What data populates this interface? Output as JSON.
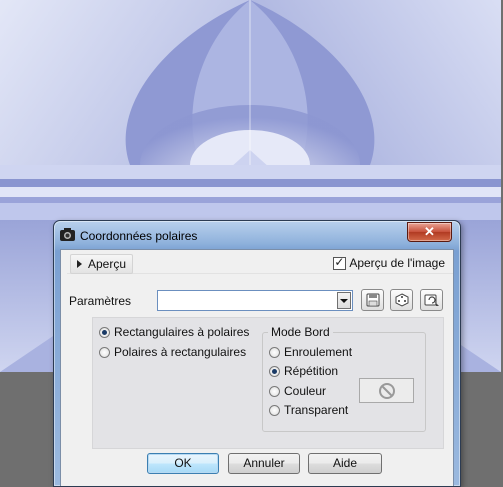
{
  "dialog": {
    "title": "Coordonnées polaires",
    "close_icon": "close-icon",
    "close_glyph": "✕",
    "preview": {
      "toggle_label": "Aperçu",
      "image_preview_label": "Aperçu de l'image",
      "image_preview_checked": true,
      "check_glyph": "✓"
    },
    "params": {
      "label": "Paramètres",
      "preset_value": "",
      "tools": [
        "save-preset-icon",
        "randomize-dice-icon",
        "reset-settings-icon"
      ]
    },
    "conversion": {
      "options": [
        {
          "label": "Rectangulaires à polaires",
          "selected": true
        },
        {
          "label": "Polaires à rectangulaires",
          "selected": false
        }
      ]
    },
    "edge_mode": {
      "title": "Mode Bord",
      "options": [
        {
          "label": "Enroulement",
          "selected": false
        },
        {
          "label": "Répétition",
          "selected": true
        },
        {
          "label": "Couleur",
          "selected": false
        },
        {
          "label": "Transparent",
          "selected": false
        }
      ],
      "color_swatch_icon": "no-color-icon"
    },
    "buttons": {
      "ok": "OK",
      "cancel": "Annuler",
      "help": "Aide"
    }
  },
  "colors": {
    "canvas_light": "#dfe3f5",
    "canvas_mid": "#a6afdc",
    "canvas_dark": "#7a86c8",
    "workspace_gray": "#6f6f6f"
  }
}
